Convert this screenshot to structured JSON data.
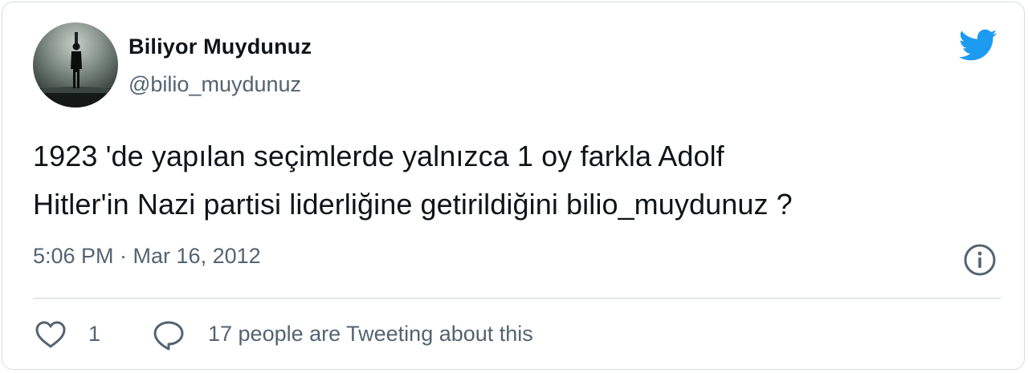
{
  "user": {
    "display_name": "Biliyor Muydunuz",
    "handle": "@bilio_muydunuz",
    "avatar": "avatar-silhouette-image"
  },
  "tweet": {
    "lines": [
      "1923 'de yapılan seçimlerde yalnızca 1 oy farkla Adolf",
      "Hitler'in Nazi partisi liderliğine getirildiğini bilio_muydunuz ?"
    ],
    "timestamp": "5:06 PM · Mar 16, 2012"
  },
  "actions": {
    "like_count": "1",
    "reply_text": "17 people are Tweeting about this"
  },
  "icons": {
    "brand": "twitter-bird-icon",
    "info": "info-icon",
    "like": "heart-icon",
    "reply": "speech-bubble-icon"
  },
  "colors": {
    "brand": "#1d9bf0",
    "text": "#0f1419",
    "secondary": "#536471",
    "border": "#d6dde3"
  }
}
